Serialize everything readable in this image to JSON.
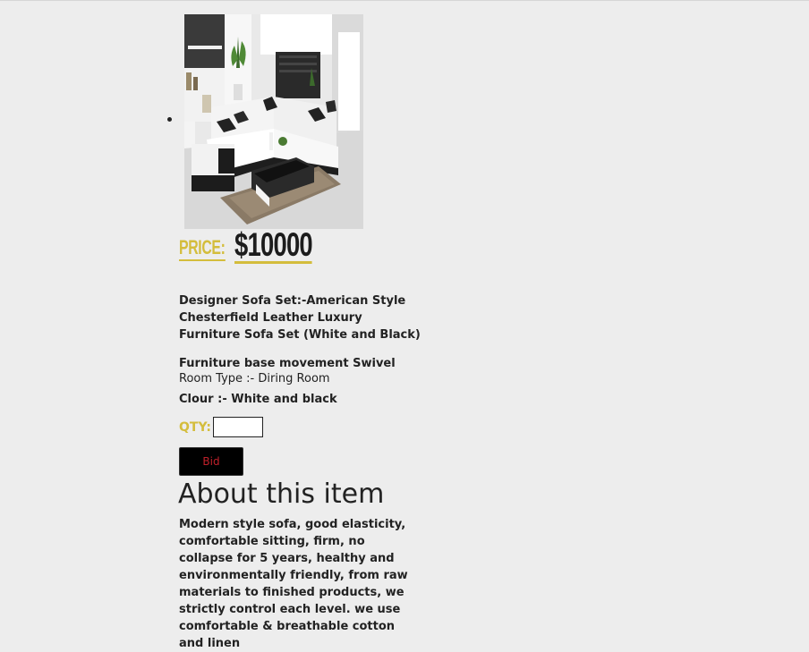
{
  "product": {
    "image_alt": "White and black L-shaped leather sofa set in a living room",
    "price_label": "PRICE:",
    "price_value": "$10000",
    "title": "Designer Sofa Set:-American Style Chesterfield Leather Luxury Furniture Sofa Set (White and Black)",
    "specs": {
      "base_movement": "Furniture base movement Swivel",
      "room_type": "Room Type :- Diring Room",
      "colour": "Clour :- White and black"
    },
    "qty_label": "QTY:",
    "qty_value": "",
    "bid_label": "Bid"
  },
  "about": {
    "heading": "About this item",
    "text": "Modern style sofa, good elasticity, comfortable sitting, firm, no collapse for 5 years, healthy and environmentally friendly, from raw materials to finished products, we strictly control each level. we use comfortable & breathable cotton and linen"
  },
  "colors": {
    "accent": "#d4bd3c",
    "background": "#ededed",
    "text": "#222222",
    "button_bg": "#000000",
    "button_text": "#c0202a"
  }
}
